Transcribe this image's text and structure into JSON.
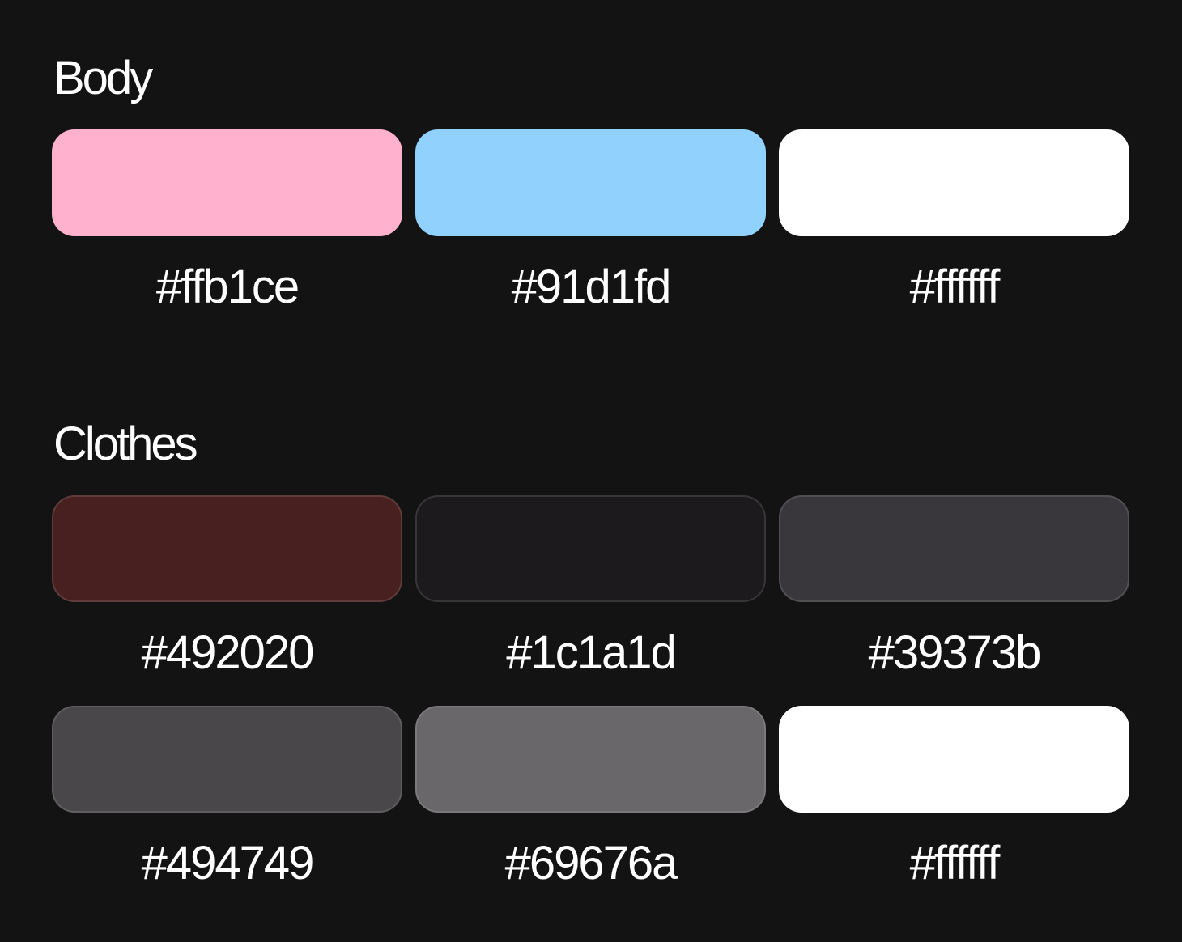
{
  "sections": [
    {
      "title": "Body",
      "swatches": [
        {
          "hex": "#ffb1ce",
          "color": "#ffb1ce"
        },
        {
          "hex": "#91d1fd",
          "color": "#91d1fd"
        },
        {
          "hex": "#ffffff",
          "color": "#ffffff"
        }
      ]
    },
    {
      "title": "Clothes",
      "swatches": [
        {
          "hex": "#492020",
          "color": "#492020"
        },
        {
          "hex": "#1c1a1d",
          "color": "#1c1a1d"
        },
        {
          "hex": "#39373b",
          "color": "#39373b"
        },
        {
          "hex": "#494749",
          "color": "#494749"
        },
        {
          "hex": "#69676a",
          "color": "#69676a"
        },
        {
          "hex": "#ffffff",
          "color": "#ffffff"
        }
      ]
    }
  ]
}
